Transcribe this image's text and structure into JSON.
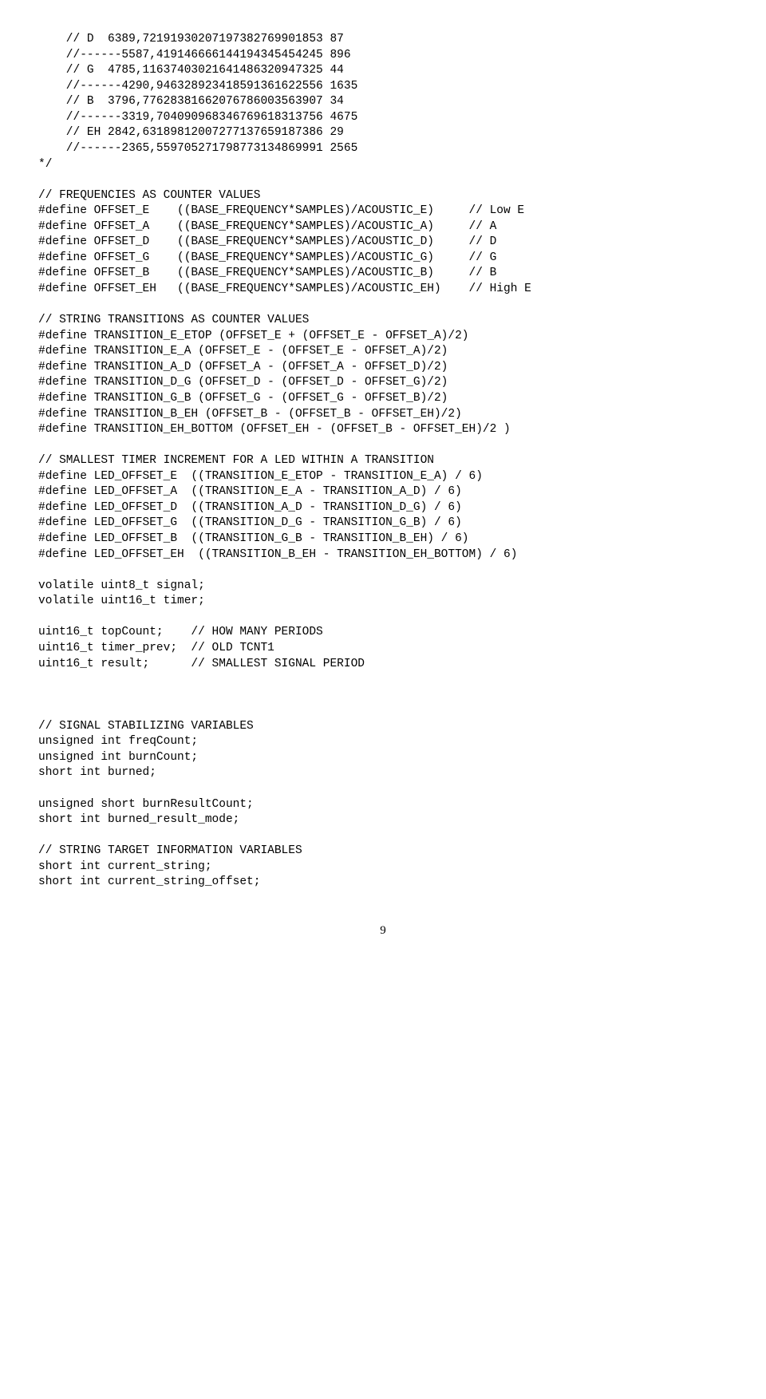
{
  "code_lines": [
    "    // D  6389,72191930207197382769901853 87",
    "    //------5587,419146666144194345454245 896",
    "    // G  4785,11637403021641486320947325 44",
    "    //------4290,946328923418591361622556 1635",
    "    // B  3796,77628381662076786003563907 34",
    "    //------3319,704090968346769618313756 4675",
    "    // EH 2842,63189812007277137659187386 29",
    "    //------2365,559705271798773134869991 2565",
    "*/",
    "",
    "// FREQUENCIES AS COUNTER VALUES",
    "#define OFFSET_E    ((BASE_FREQUENCY*SAMPLES)/ACOUSTIC_E)     // Low E",
    "#define OFFSET_A    ((BASE_FREQUENCY*SAMPLES)/ACOUSTIC_A)     // A",
    "#define OFFSET_D    ((BASE_FREQUENCY*SAMPLES)/ACOUSTIC_D)     // D",
    "#define OFFSET_G    ((BASE_FREQUENCY*SAMPLES)/ACOUSTIC_G)     // G",
    "#define OFFSET_B    ((BASE_FREQUENCY*SAMPLES)/ACOUSTIC_B)     // B",
    "#define OFFSET_EH   ((BASE_FREQUENCY*SAMPLES)/ACOUSTIC_EH)    // High E",
    "",
    "// STRING TRANSITIONS AS COUNTER VALUES",
    "#define TRANSITION_E_ETOP (OFFSET_E + (OFFSET_E - OFFSET_A)/2)",
    "#define TRANSITION_E_A (OFFSET_E - (OFFSET_E - OFFSET_A)/2)",
    "#define TRANSITION_A_D (OFFSET_A - (OFFSET_A - OFFSET_D)/2)",
    "#define TRANSITION_D_G (OFFSET_D - (OFFSET_D - OFFSET_G)/2)",
    "#define TRANSITION_G_B (OFFSET_G - (OFFSET_G - OFFSET_B)/2)",
    "#define TRANSITION_B_EH (OFFSET_B - (OFFSET_B - OFFSET_EH)/2)",
    "#define TRANSITION_EH_BOTTOM (OFFSET_EH - (OFFSET_B - OFFSET_EH)/2 )",
    "",
    "// SMALLEST TIMER INCREMENT FOR A LED WITHIN A TRANSITION",
    "#define LED_OFFSET_E  ((TRANSITION_E_ETOP - TRANSITION_E_A) / 6)",
    "#define LED_OFFSET_A  ((TRANSITION_E_A - TRANSITION_A_D) / 6)",
    "#define LED_OFFSET_D  ((TRANSITION_A_D - TRANSITION_D_G) / 6)",
    "#define LED_OFFSET_G  ((TRANSITION_D_G - TRANSITION_G_B) / 6)",
    "#define LED_OFFSET_B  ((TRANSITION_G_B - TRANSITION_B_EH) / 6)",
    "#define LED_OFFSET_EH  ((TRANSITION_B_EH - TRANSITION_EH_BOTTOM) / 6)",
    "",
    "volatile uint8_t signal;",
    "volatile uint16_t timer;",
    "",
    "uint16_t topCount;    // HOW MANY PERIODS",
    "uint16_t timer_prev;  // OLD TCNT1",
    "uint16_t result;      // SMALLEST SIGNAL PERIOD",
    "",
    "",
    "",
    "// SIGNAL STABILIZING VARIABLES",
    "unsigned int freqCount;",
    "unsigned int burnCount;",
    "short int burned;",
    "",
    "unsigned short burnResultCount;",
    "short int burned_result_mode;",
    "",
    "// STRING TARGET INFORMATION VARIABLES",
    "short int current_string;",
    "short int current_string_offset;"
  ],
  "page_number": "9"
}
